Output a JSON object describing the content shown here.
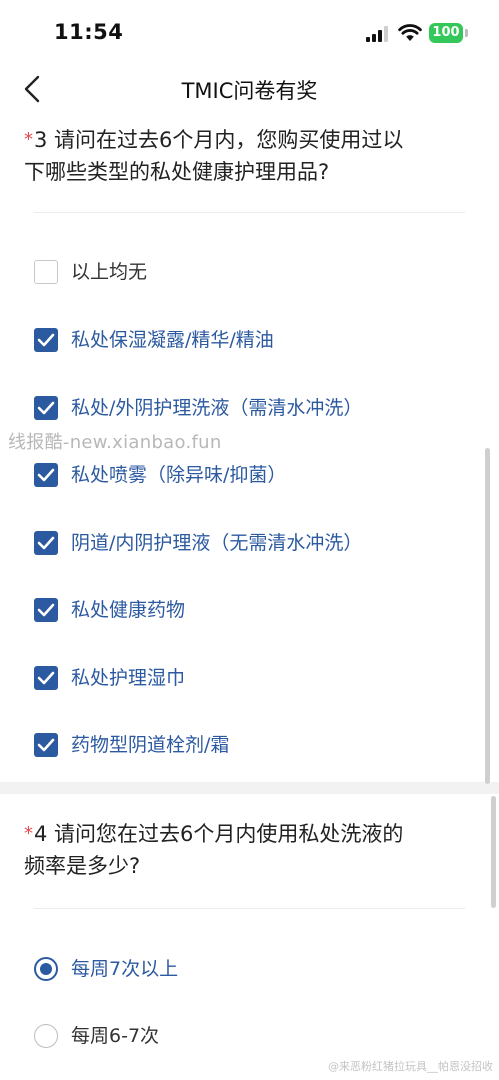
{
  "status_bar": {
    "time": "11:54",
    "battery": "100"
  },
  "nav": {
    "title": "TMIC问卷有奖"
  },
  "q3": {
    "required_mark": "*",
    "line1": "3 请问在过去6个月内，您购买使用过以",
    "line2": "下哪些类型的私处健康护理用品?",
    "options": [
      {
        "label": "以上均无",
        "checked": false
      },
      {
        "label": "私处保湿凝露/精华/精油",
        "checked": true
      },
      {
        "label": "私处/外阴护理洗液（需清水冲洗）",
        "checked": true
      },
      {
        "label": "私处喷雾（除异味/抑菌）",
        "checked": true
      },
      {
        "label": "阴道/内阴护理液（无需清水冲洗）",
        "checked": true
      },
      {
        "label": "私处健康药物",
        "checked": true
      },
      {
        "label": "私处护理湿巾",
        "checked": true
      },
      {
        "label": "药物型阴道栓剂/霜",
        "checked": true
      }
    ]
  },
  "q4": {
    "required_mark": "*",
    "line1": "4 请问您在过去6个月内使用私处洗液的",
    "line2": "频率是多少?",
    "options": [
      {
        "label": "每周7次以上",
        "checked": true
      },
      {
        "label": "每周6-7次",
        "checked": false
      }
    ]
  },
  "watermark": {
    "text": "线报酷-new.xianbao.fun"
  },
  "footer_watermark": {
    "text": "@来恶粉红猪拉玩具__帕恩没招收"
  },
  "colors": {
    "accent": "#2c5aa0",
    "required": "#e5484d",
    "battery": "#34c759"
  }
}
